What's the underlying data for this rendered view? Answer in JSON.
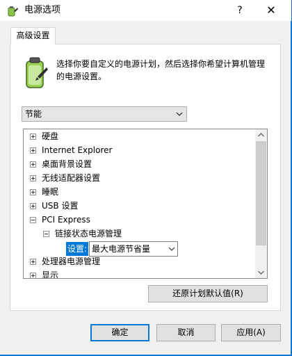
{
  "window": {
    "title": "电源选项",
    "help_label": "?",
    "close_label": "✕"
  },
  "tab": {
    "label": "高级设置"
  },
  "description": "选择你要自定义的电源计划，然后选择你希望计算机管理的电源设置。",
  "plan_select": {
    "value": "节能"
  },
  "tree": {
    "items": [
      {
        "label": "硬盘",
        "state": "collapsed"
      },
      {
        "label": "Internet Explorer",
        "state": "collapsed"
      },
      {
        "label": "桌面背景设置",
        "state": "collapsed"
      },
      {
        "label": "无线适配器设置",
        "state": "collapsed"
      },
      {
        "label": "睡眠",
        "state": "collapsed"
      },
      {
        "label": "USB 设置",
        "state": "collapsed"
      },
      {
        "label": "PCI Express",
        "state": "expanded"
      },
      {
        "label": "链接状态电源管理",
        "state": "expanded"
      },
      {
        "label": "处理器电源管理",
        "state": "collapsed"
      },
      {
        "label": "显示",
        "state": "collapsed"
      }
    ],
    "setting": {
      "label": "设置:",
      "value": "最大电源节省量"
    }
  },
  "buttons": {
    "restore": "还原计划默认值(R)",
    "ok": "确定",
    "cancel": "取消",
    "apply": "应用(A)"
  },
  "colors": {
    "accent": "#0078d7",
    "desktop": "#0a78d4"
  }
}
